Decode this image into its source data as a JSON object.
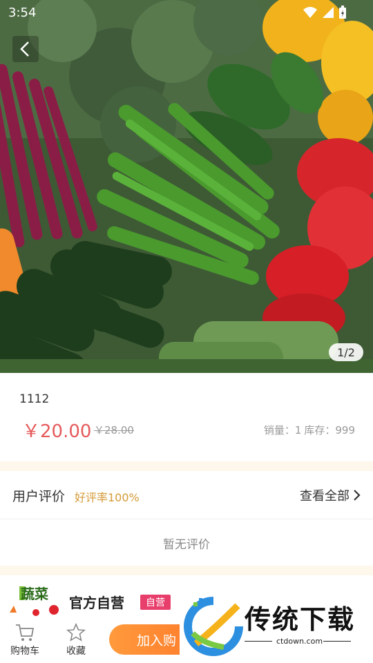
{
  "status_bar": {
    "time": "3:54"
  },
  "gallery": {
    "counter": "1/2"
  },
  "product": {
    "name": "1112",
    "price": "￥20.00",
    "old_price": "￥28.00",
    "sales": "销量：1",
    "stock": "库存：999"
  },
  "reviews": {
    "title": "用户评价",
    "good_rate": "好评率100%",
    "view_all": "查看全部",
    "empty": "暂无评价"
  },
  "shop": {
    "name": "官方自营",
    "badge": "自营",
    "logo_text": "蔬菜"
  },
  "bottom_bar": {
    "cart": "购物车",
    "favorite": "收藏",
    "add_to_cart": "加入购"
  },
  "watermark": {
    "text": "传统下载",
    "url": "ctdown.com"
  },
  "colors": {
    "price": "#e65a5a",
    "good_rate": "#d59a37",
    "badge": "#e83e6c",
    "button": "#ff8a33"
  }
}
